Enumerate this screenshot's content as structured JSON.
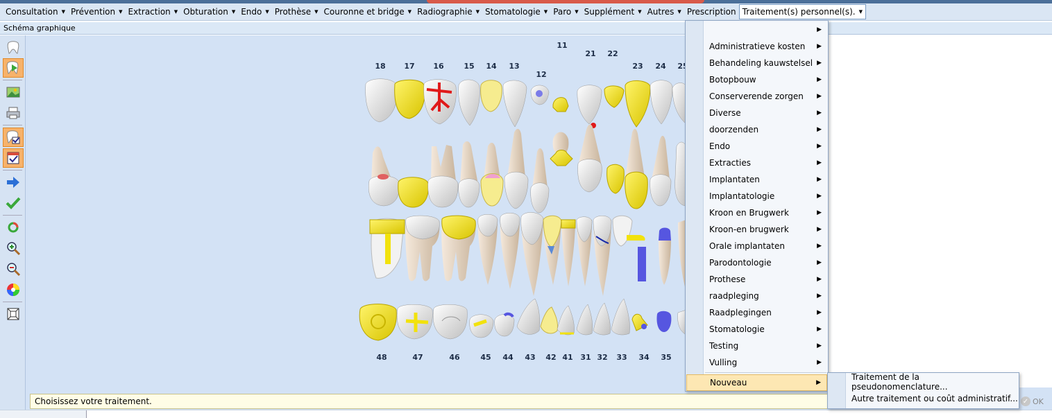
{
  "menubar": {
    "items": [
      {
        "label": "Consultation"
      },
      {
        "label": "Prévention"
      },
      {
        "label": "Extraction"
      },
      {
        "label": "Obturation"
      },
      {
        "label": "Endo"
      },
      {
        "label": "Prothèse"
      },
      {
        "label": "Couronne et bridge"
      },
      {
        "label": "Radiographie"
      },
      {
        "label": "Stomatologie"
      },
      {
        "label": "Paro"
      },
      {
        "label": "Supplément"
      },
      {
        "label": "Autres"
      },
      {
        "label": "Prescription"
      },
      {
        "label": "Traitement(s) personnel(s)."
      }
    ]
  },
  "panel": {
    "title": "Schéma graphique"
  },
  "sidebar": {
    "tools": [
      "tooth-icon",
      "tooth-play-icon",
      "image-icon",
      "printer-icon",
      "tooth-check-icon",
      "calendar-check-icon",
      "arrow-right-icon",
      "checkmark-icon",
      "recycle-icon",
      "zoom-in-icon",
      "zoom-out-icon",
      "color-wheel-icon",
      "frame-icon"
    ]
  },
  "chart": {
    "upper_numbers": [
      {
        "n": "18"
      },
      {
        "n": "17"
      },
      {
        "n": "16"
      },
      {
        "n": "15"
      },
      {
        "n": "14"
      },
      {
        "n": "13"
      },
      {
        "n": "12"
      },
      {
        "n": "11"
      },
      {
        "n": "21"
      },
      {
        "n": "22"
      },
      {
        "n": "23"
      },
      {
        "n": "24"
      },
      {
        "n": "25"
      }
    ],
    "lower_numbers": [
      {
        "n": "48"
      },
      {
        "n": "47"
      },
      {
        "n": "46"
      },
      {
        "n": "45"
      },
      {
        "n": "44"
      },
      {
        "n": "43"
      },
      {
        "n": "42"
      },
      {
        "n": "41"
      },
      {
        "n": "31"
      },
      {
        "n": "32"
      },
      {
        "n": "33"
      },
      {
        "n": "34"
      },
      {
        "n": "35"
      }
    ]
  },
  "status": {
    "message": "Choisissez votre traitement.",
    "ok_label": "OK"
  },
  "dropdown": {
    "items": [
      {
        "label": ""
      },
      {
        "label": "Administratieve kosten"
      },
      {
        "label": "Behandeling kauwstelsel"
      },
      {
        "label": "Botopbouw"
      },
      {
        "label": "Conserverende zorgen"
      },
      {
        "label": "Diverse"
      },
      {
        "label": "doorzenden"
      },
      {
        "label": "Endo"
      },
      {
        "label": "Extracties"
      },
      {
        "label": "Implantaten"
      },
      {
        "label": "Implantatologie"
      },
      {
        "label": "Kroon en Brugwerk"
      },
      {
        "label": "Kroon-en brugwerk"
      },
      {
        "label": "Orale implantaten"
      },
      {
        "label": "Parodontologie"
      },
      {
        "label": "Prothese"
      },
      {
        "label": "raadpleging"
      },
      {
        "label": "Raadplegingen"
      },
      {
        "label": "Stomatologie"
      },
      {
        "label": "Testing"
      },
      {
        "label": "Vulling"
      }
    ],
    "highlighted": {
      "label": "Nouveau"
    }
  },
  "submenu": {
    "items": [
      {
        "label": "Traitement de la pseudonomenclature..."
      },
      {
        "label": "Autre traitement ou coût administratif..."
      }
    ]
  },
  "colors": {
    "menubar_bg": "#dae6f4",
    "chart_bg": "#d3e2f5",
    "highlight": "#fde7b3",
    "crown_yellow": "#f2e20c",
    "implant_blue": "#5656e0",
    "caries_red": "#e01a1a"
  }
}
